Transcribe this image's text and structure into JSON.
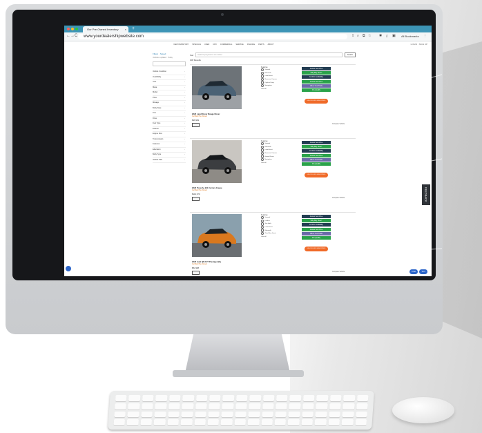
{
  "browser": {
    "tab_title": "Our Pre-Owned Inventory",
    "tab_close": "×",
    "new_tab": "+",
    "url": "www.yourdealershipwebsite.com",
    "back": "←",
    "forward": "→",
    "reload": "C",
    "bookmarks_label": "All Bookmarks"
  },
  "site": {
    "top_nav": [
      "NEW INVENTORY",
      "SPECIALS",
      "USED",
      "CPO",
      "COMMERCIAL",
      "SERVICE",
      "FINANCE",
      "PARTS",
      "ABOUT"
    ],
    "right_links": "LOGIN · SIGN UP",
    "sidebar": {
      "heading": "Filters · Saved",
      "subheading": "Vehicles updated · Today",
      "filters": [
        "Vehicle Condition",
        "Availability",
        "Year",
        "Make",
        "Model",
        "Price",
        "Mileage",
        "Body Style",
        "Trim",
        "Drive",
        "Fuel Type",
        "Exterior",
        "Engine Size",
        "Transmission",
        "Features",
        "Education",
        "Body Type",
        "Vehicle Pick"
      ]
    },
    "search": {
      "sort_label": "Sort",
      "placeholder": "Search by keyword or vin number",
      "button": "Search"
    },
    "results_label": "108 Results",
    "features_title": "Features",
    "compare_label": "Compare Vehicle",
    "price_tag": "UNLOCK EXCLUSIVE PRICE",
    "cta_buttons": [
      "Instant Test Drive",
      "Why Buy Here?",
      "Confirm Availability",
      "Instant Test Drive",
      "Value Your Trade",
      "Pre-Qualify"
    ],
    "vehicles": [
      {
        "name": "2022 Land Rover Range Rover",
        "sub": "Certified Pre-Owned",
        "price": "$98,999",
        "features": [
          "Sunroof",
          "Bluetooth",
          "Lane Assist",
          "Rearview Camera",
          "Keyless Entry",
          "Navigation"
        ],
        "more": "View all"
      },
      {
        "name": "2022 Porsche 911 Carrera Coupe",
        "sub": "Certified Pre-Owned",
        "price": "$119,970",
        "features": [
          "Sunroof",
          "Bluetooth",
          "Lane Assist",
          "Rearview Camera",
          "Heated Seats",
          "Navigation"
        ],
        "more": "View all"
      },
      {
        "name": "2022 Audi Q8 3.0T Prestige Qtly",
        "sub": "Certified Pre-Owned",
        "price": "$82,998",
        "features": [
          "Sunroof",
          "Leather",
          "Tow Hitch",
          "Lane Assist",
          "Bluetooth",
          "Third Row Seats"
        ],
        "more": "View all"
      }
    ],
    "float_buttons": [
      "Chat",
      "Text"
    ]
  },
  "side_tab_label": "FEEDBACK",
  "colors": {
    "browser_chrome": "#3d95b6",
    "button_dark": "#233d52",
    "button_green": "#2aa24a",
    "button_purple": "#6b6ba8",
    "price_orange": "#f06a28",
    "chat_blue": "#2c65c9"
  }
}
